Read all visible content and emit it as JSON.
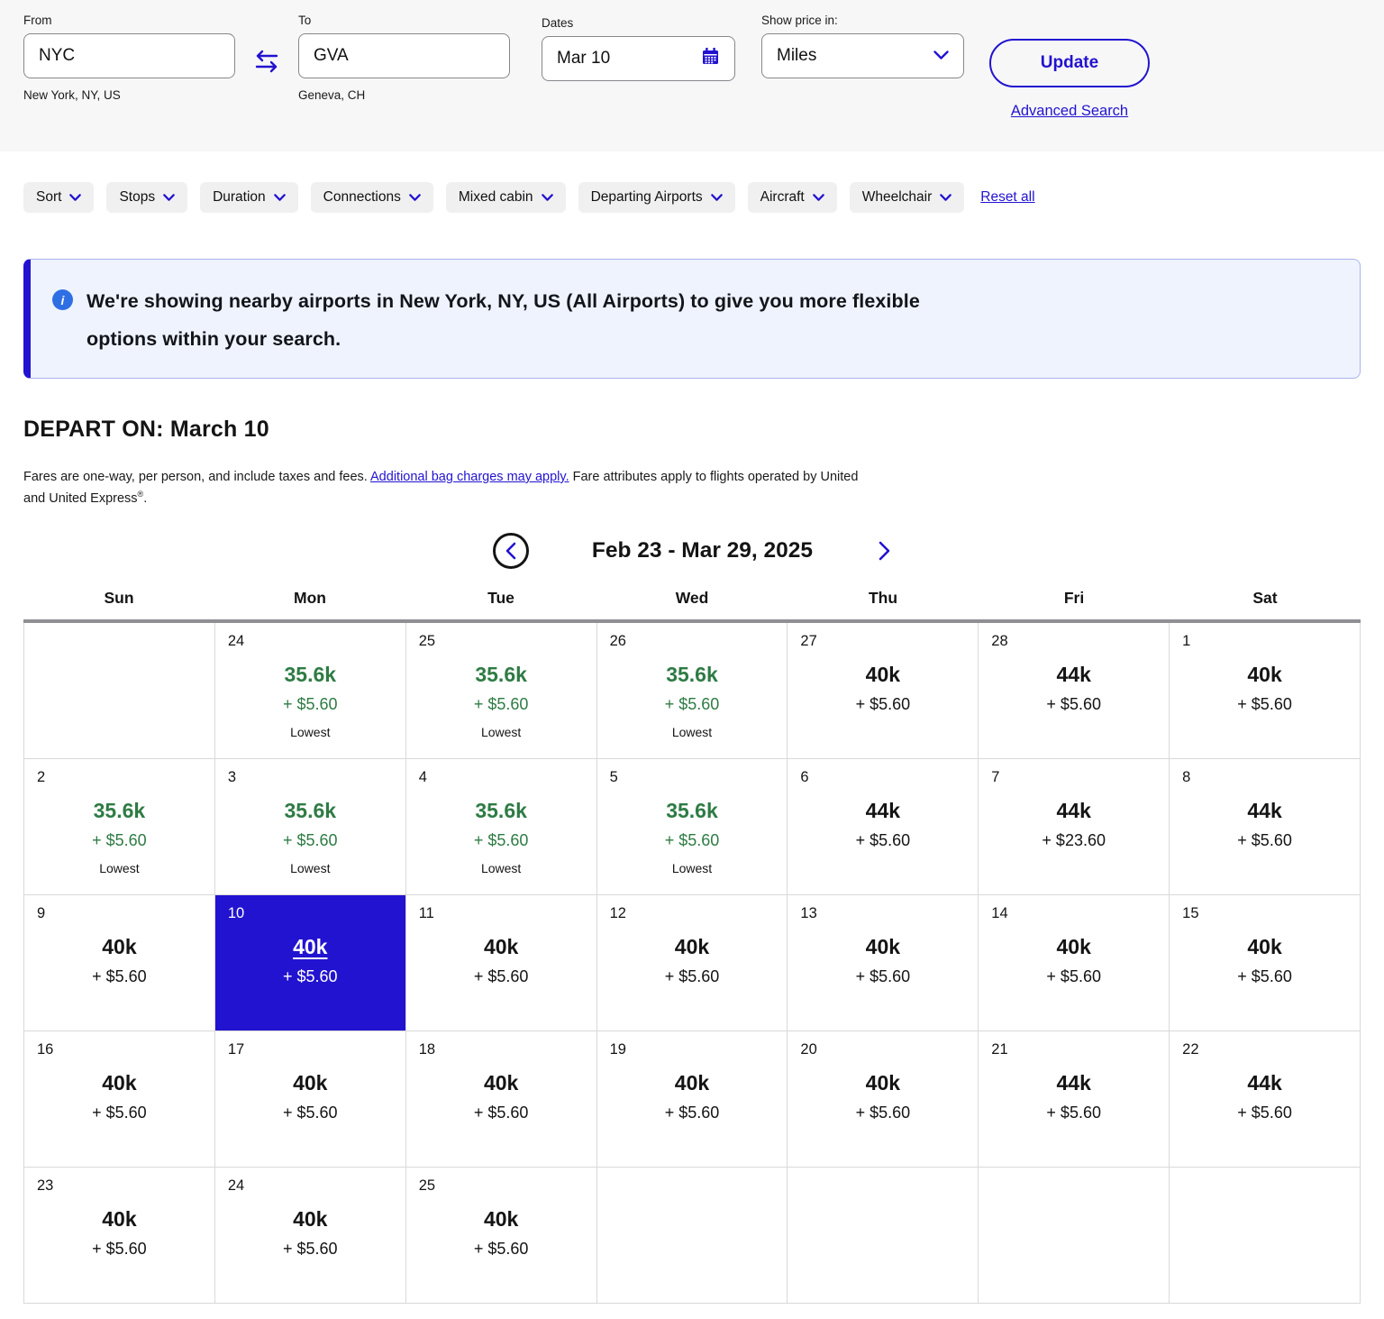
{
  "search": {
    "from_label": "From",
    "from_value": "NYC",
    "from_helper": "New York, NY, US",
    "to_label": "To",
    "to_value": "GVA",
    "to_helper": "Geneva, CH",
    "dates_label": "Dates",
    "dates_value": "Mar 10",
    "price_label": "Show price in:",
    "price_value": "Miles",
    "update_label": "Update",
    "advanced_label": "Advanced Search"
  },
  "filters": {
    "items": [
      "Sort",
      "Stops",
      "Duration",
      "Connections",
      "Mixed cabin",
      "Departing Airports",
      "Aircraft",
      "Wheelchair"
    ],
    "reset_label": "Reset all"
  },
  "banner": {
    "text": "We're showing nearby airports in New York, NY, US (All Airports) to give you more flexible options within your search."
  },
  "depart": {
    "heading": "DEPART ON: March 10",
    "disclaimer_pre": "Fares are one-way, per person, and include taxes and fees. ",
    "disclaimer_link": "Additional bag charges may apply.",
    "disclaimer_mid": " Fare attributes apply to flights operated by United and United Express",
    "disclaimer_sup": "®",
    "disclaimer_end": "."
  },
  "icons": {
    "info_glyph": "i",
    "swap": "swap-horizontal-icon",
    "calendar": "calendar-icon",
    "chevron_down": "chevron-down-icon",
    "chevron_left": "chevron-left-icon",
    "chevron_right": "chevron-right-icon"
  },
  "calendar": {
    "range_label": "Feb 23 - Mar 29, 2025",
    "day_headers": [
      "Sun",
      "Mon",
      "Tue",
      "Wed",
      "Thu",
      "Fri",
      "Sat"
    ],
    "rows": [
      [
        null,
        {
          "day": "24",
          "miles": "35.6k",
          "cash": "+ $5.60",
          "tag": "Lowest",
          "lowest": true
        },
        {
          "day": "25",
          "miles": "35.6k",
          "cash": "+ $5.60",
          "tag": "Lowest",
          "lowest": true
        },
        {
          "day": "26",
          "miles": "35.6k",
          "cash": "+ $5.60",
          "tag": "Lowest",
          "lowest": true
        },
        {
          "day": "27",
          "miles": "40k",
          "cash": "+ $5.60"
        },
        {
          "day": "28",
          "miles": "44k",
          "cash": "+ $5.60"
        },
        {
          "day": "1",
          "miles": "40k",
          "cash": "+ $5.60"
        }
      ],
      [
        {
          "day": "2",
          "miles": "35.6k",
          "cash": "+ $5.60",
          "tag": "Lowest",
          "lowest": true
        },
        {
          "day": "3",
          "miles": "35.6k",
          "cash": "+ $5.60",
          "tag": "Lowest",
          "lowest": true
        },
        {
          "day": "4",
          "miles": "35.6k",
          "cash": "+ $5.60",
          "tag": "Lowest",
          "lowest": true
        },
        {
          "day": "5",
          "miles": "35.6k",
          "cash": "+ $5.60",
          "tag": "Lowest",
          "lowest": true
        },
        {
          "day": "6",
          "miles": "44k",
          "cash": "+ $5.60"
        },
        {
          "day": "7",
          "miles": "44k",
          "cash": "+ $23.60"
        },
        {
          "day": "8",
          "miles": "44k",
          "cash": "+ $5.60"
        }
      ],
      [
        {
          "day": "9",
          "miles": "40k",
          "cash": "+ $5.60"
        },
        {
          "day": "10",
          "miles": "40k",
          "cash": "+ $5.60",
          "selected": true
        },
        {
          "day": "11",
          "miles": "40k",
          "cash": "+ $5.60"
        },
        {
          "day": "12",
          "miles": "40k",
          "cash": "+ $5.60"
        },
        {
          "day": "13",
          "miles": "40k",
          "cash": "+ $5.60"
        },
        {
          "day": "14",
          "miles": "40k",
          "cash": "+ $5.60"
        },
        {
          "day": "15",
          "miles": "40k",
          "cash": "+ $5.60"
        }
      ],
      [
        {
          "day": "16",
          "miles": "40k",
          "cash": "+ $5.60"
        },
        {
          "day": "17",
          "miles": "40k",
          "cash": "+ $5.60"
        },
        {
          "day": "18",
          "miles": "40k",
          "cash": "+ $5.60"
        },
        {
          "day": "19",
          "miles": "40k",
          "cash": "+ $5.60"
        },
        {
          "day": "20",
          "miles": "40k",
          "cash": "+ $5.60"
        },
        {
          "day": "21",
          "miles": "44k",
          "cash": "+ $5.60"
        },
        {
          "day": "22",
          "miles": "44k",
          "cash": "+ $5.60"
        }
      ],
      [
        {
          "day": "23",
          "miles": "40k",
          "cash": "+ $5.60"
        },
        {
          "day": "24",
          "miles": "40k",
          "cash": "+ $5.60"
        },
        {
          "day": "25",
          "miles": "40k",
          "cash": "+ $5.60"
        },
        null,
        null,
        null,
        null
      ]
    ]
  },
  "colors": {
    "accent_blue": "#2213d0",
    "lowest_green": "#2e7b44",
    "selected_day_bg": "#2213d0",
    "banner_bg": "#eff3fd",
    "topbar_bg": "#f7f7f7"
  }
}
